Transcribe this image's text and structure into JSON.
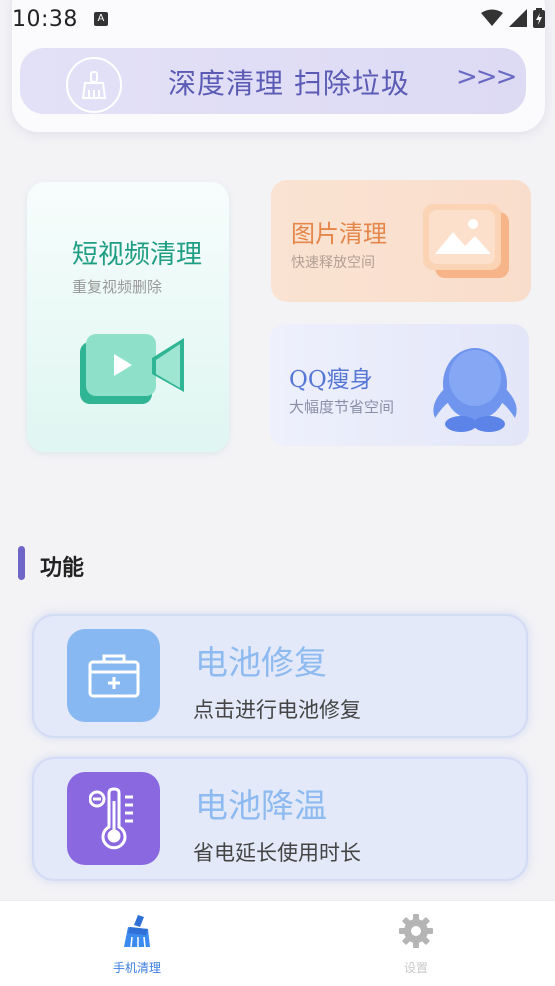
{
  "status_bar": {
    "time": "10:38",
    "notification_glyph": "A"
  },
  "top_card": {
    "deep_clean_label": "深度清理  扫除垃圾",
    "deep_clean_arrow": ">>>"
  },
  "cards": {
    "video": {
      "title": "短视频清理",
      "subtitle": "重复视频删除"
    },
    "image": {
      "title": "图片清理",
      "subtitle": "快速释放空间"
    },
    "qq": {
      "title": "QQ瘦身",
      "subtitle": "大幅度节省空间"
    }
  },
  "section": {
    "title": "功能"
  },
  "features": [
    {
      "title": "电池修复",
      "subtitle": "点击进行电池修复",
      "icon": "first-aid-kit-icon"
    },
    {
      "title": "电池降温",
      "subtitle": "省电延长使用时长",
      "icon": "thermometer-icon"
    }
  ],
  "bottom_nav": {
    "home_label": "手机清理",
    "settings_label": "设置"
  },
  "colors": {
    "accent": "#6f65c9",
    "video_green": "#1f9e84",
    "image_orange": "#e5874a",
    "qq_blue": "#5677d4",
    "feature_title": "#8dbaf0",
    "nav_active": "#3b7ee0"
  }
}
